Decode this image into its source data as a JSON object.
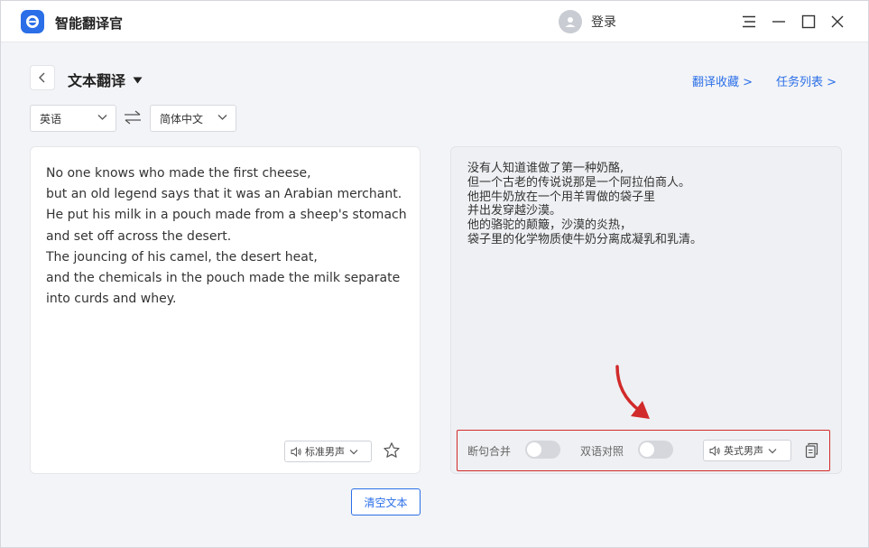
{
  "app": {
    "title": "智能翻译官",
    "login_label": "登录"
  },
  "header": {
    "page_title": "文本翻译",
    "links": [
      "翻译收藏 >",
      "任务列表 >"
    ]
  },
  "languages": {
    "source": "英语",
    "target": "简体中文"
  },
  "source_panel": {
    "text": "No one knows who made the first cheese,\nbut an old legend says that it was an Arabian merchant.\nHe put his milk in a pouch made from a sheep's stomach\nand set off across the desert.\nThe jouncing of his camel, the desert heat,\nand the chemicals in the pouch made the milk separate\ninto curds and whey.",
    "voice": "标准男声"
  },
  "target_panel": {
    "text": "没有人知道谁做了第一种奶酪,\n但一个古老的传说说那是一个阿拉伯商人。\n他把牛奶放在一个用羊胃做的袋子里\n并出发穿越沙漠。\n他的骆驼的颠簸，沙漠的炎热，\n袋子里的化学物质使牛奶分离成凝乳和乳清。",
    "toggle_merge": "断句合并",
    "toggle_bilingual": "双语对照",
    "voice": "英式男声"
  },
  "actions": {
    "clear": "清空文本"
  },
  "colors": {
    "accent": "#2b6fe8",
    "highlight": "#d12a2a"
  }
}
